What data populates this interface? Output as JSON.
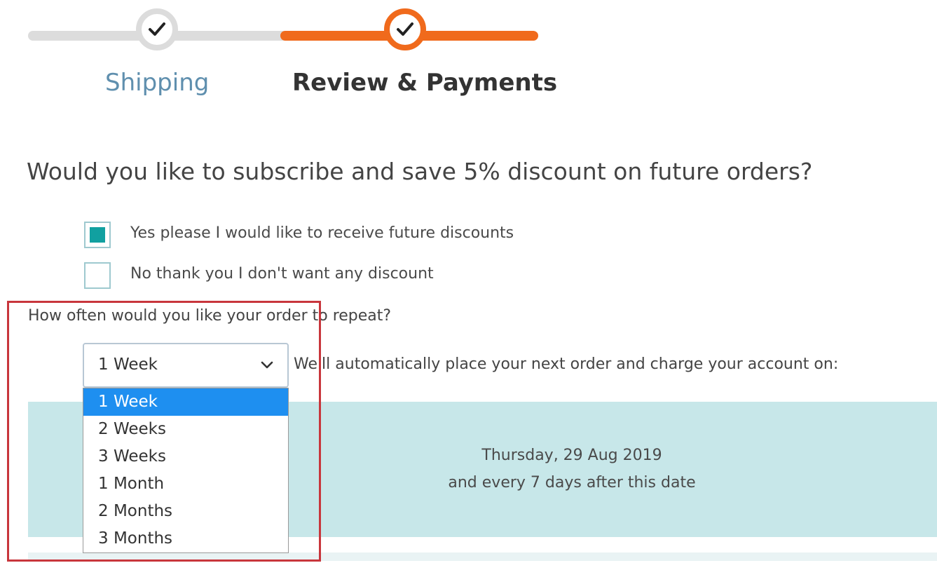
{
  "steps": [
    {
      "label": "Shipping",
      "status": "complete"
    },
    {
      "label": "Review & Payments",
      "status": "current"
    }
  ],
  "colors": {
    "accent": "#f06a1c",
    "inactive_track": "#dcdcdc",
    "checkbox_fill": "#11a0a0",
    "panel_bg": "#c7e7e9",
    "option_highlight": "#1e8ff0",
    "highlight_border": "#c8363c"
  },
  "subscription": {
    "question": "Would you like to subscribe and save 5% discount on future orders?",
    "options": [
      {
        "label": "Yes please I would like to receive future discounts",
        "checked": true
      },
      {
        "label": "No thank you I don't want any discount",
        "checked": false
      }
    ]
  },
  "repeat": {
    "question": "How often would you like your order to repeat?",
    "selected": "1 Week",
    "options": [
      "1 Week",
      "2 Weeks",
      "3 Weeks",
      "1 Month",
      "2 Months",
      "3 Months"
    ],
    "auto_text": "We'll automatically place your next order and charge your account on:"
  },
  "schedule": {
    "date": "Thursday, 29 Aug 2019",
    "recurrence": "and every 7 days after this date"
  },
  "icons": {
    "step_complete": "check-icon",
    "dropdown": "chevron-down-icon"
  }
}
